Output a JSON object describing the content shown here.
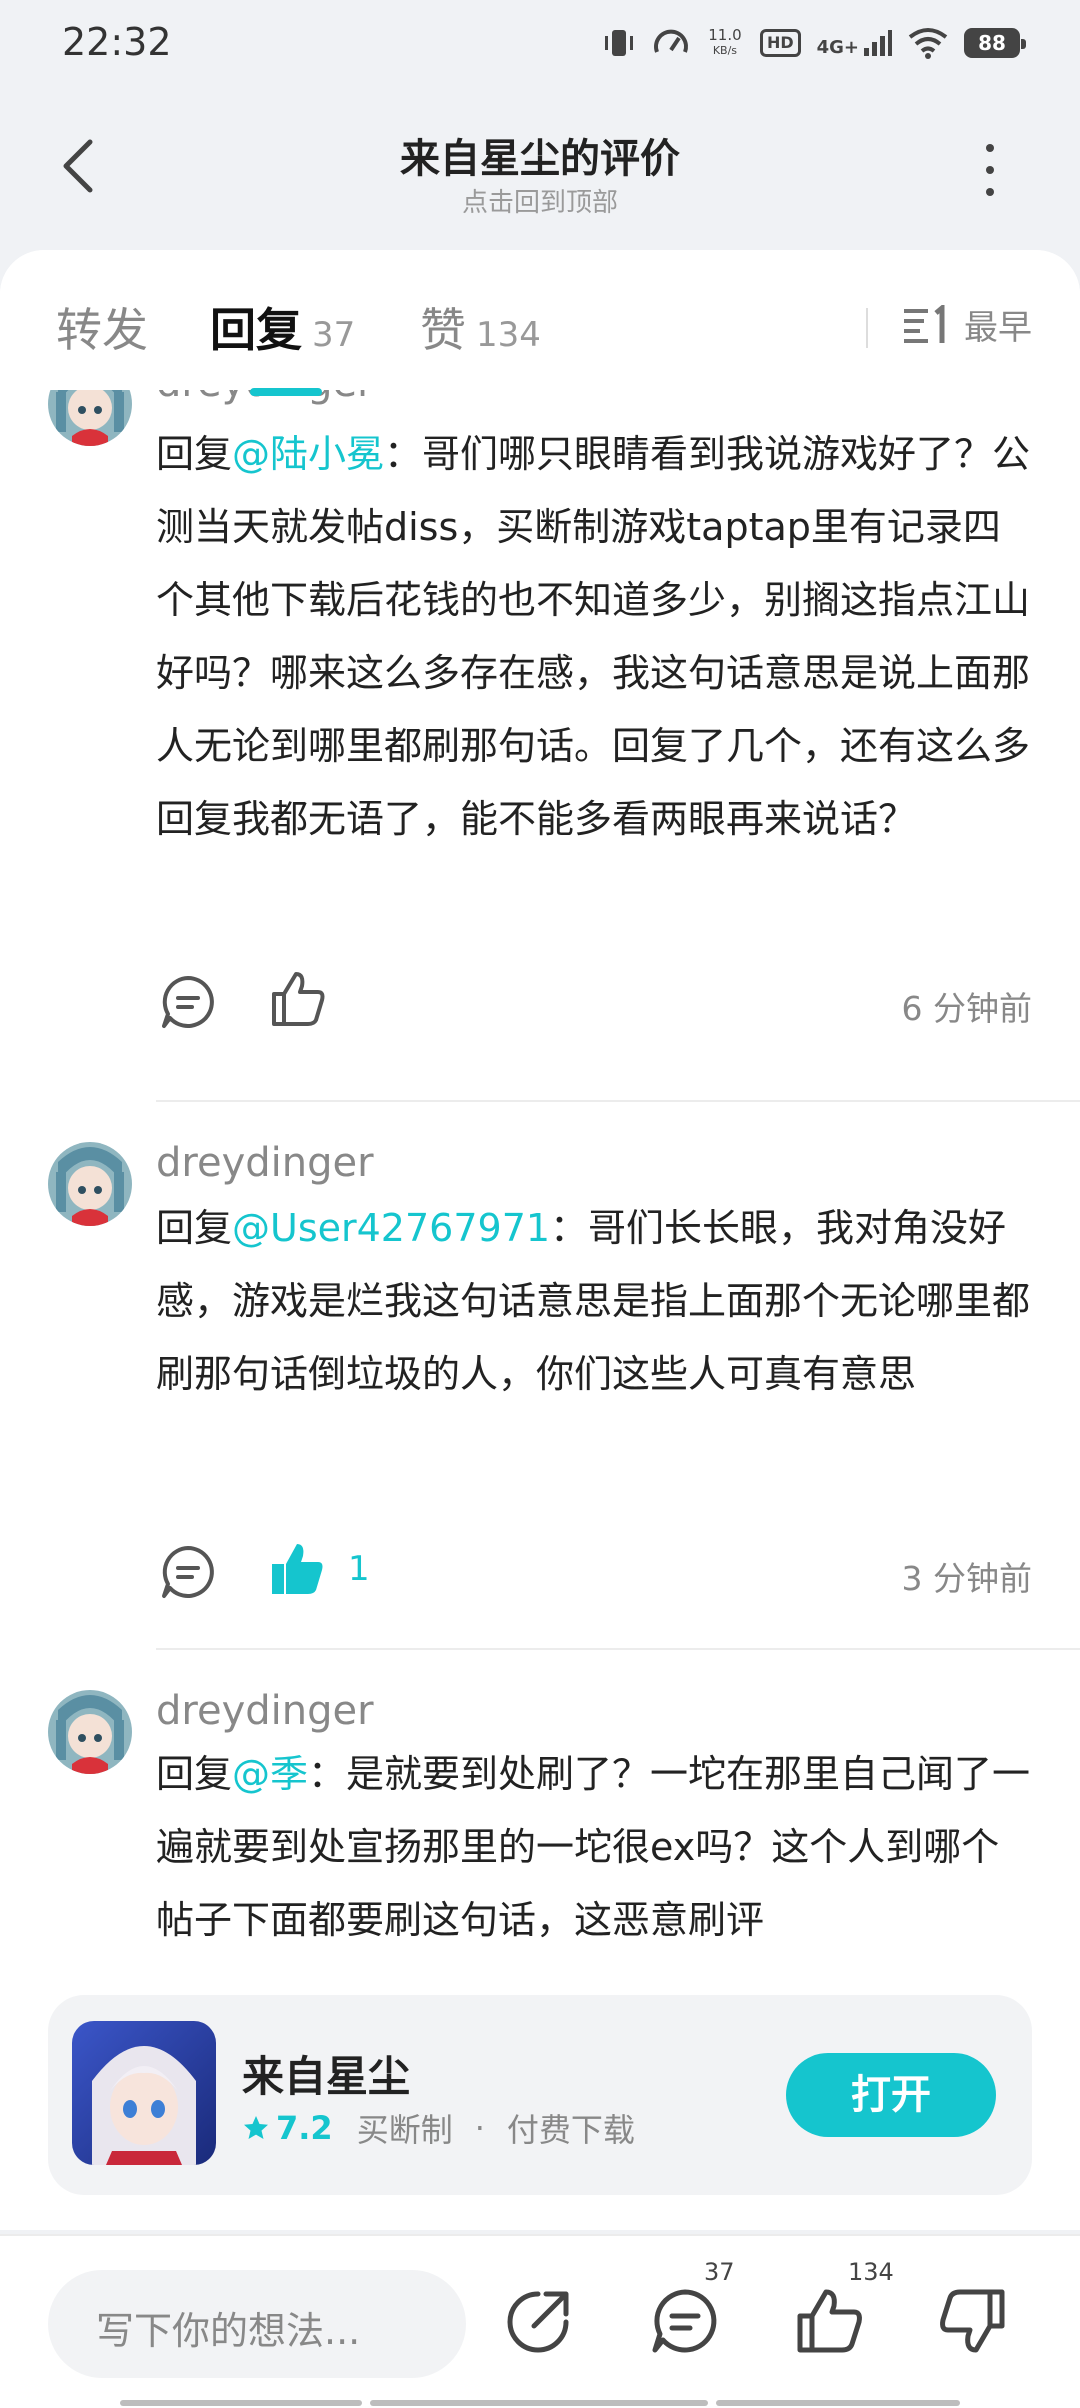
{
  "status_bar": {
    "time": "22:32",
    "speed_value": "11.0",
    "speed_unit": "KB/s",
    "hd": "HD",
    "network": "4G+",
    "battery": "88"
  },
  "header": {
    "title": "来自星尘的评价",
    "subtitle": "点击回到顶部"
  },
  "tabs": [
    {
      "label": "转发",
      "count": ""
    },
    {
      "label": "回复",
      "count": "37"
    },
    {
      "label": "赞",
      "count": "134"
    }
  ],
  "sort": {
    "label": "最早"
  },
  "comments": [
    {
      "username": "dreydinger",
      "reply_prefix": "回复",
      "mention": "@陆小冕",
      "text": "：哥们哪只眼睛看到我说游戏好了？公测当天就发帖diss，买断制游戏taptap里有记录四个其他下载后花钱的也不知道多少，别搁这指点江山好吗？哪来这么多存在感，我这句话意思是说上面那人无论到哪里都刷那句话。回复了几个，还有这么多回复我都无语了，能不能多看两眼再来说话？",
      "likes": "",
      "liked": false,
      "time": "6 分钟前"
    },
    {
      "username": "dreydinger",
      "reply_prefix": "回复",
      "mention": "@User42767971",
      "text": "：哥们长长眼，我对角没好感，游戏是烂我这句话意思是指上面那个无论哪里都刷那句话倒垃圾的人，你们这些人可真有意思",
      "likes": "1",
      "liked": true,
      "time": "3 分钟前"
    },
    {
      "username": "dreydinger",
      "reply_prefix": "回复",
      "mention": "@季",
      "text": "：是就要到处刷了？一坨在那里自己闻了一遍就要到处宣扬那里的一坨很ex吗？这个人到哪个帖子下面都要刷这句话，这恶意刷评",
      "likes": "",
      "liked": false,
      "time": ""
    }
  ],
  "game": {
    "name": "来自星尘",
    "rating": "7.2",
    "tag1": "买断制",
    "separator": "·",
    "tag2": "付费下载",
    "open_label": "打开"
  },
  "bottom_bar": {
    "placeholder": "写下你的想法...",
    "reply_count": "37",
    "like_count": "134"
  },
  "colors": {
    "accent": "#15c5ce",
    "text": "#222222",
    "muted": "#888888",
    "background": "#f0f2f5"
  },
  "icons": [
    "back-icon",
    "more-icon",
    "sort-icon",
    "reply-icon",
    "like-icon",
    "share-icon",
    "comment-icon",
    "dislike-icon",
    "star-icon"
  ]
}
